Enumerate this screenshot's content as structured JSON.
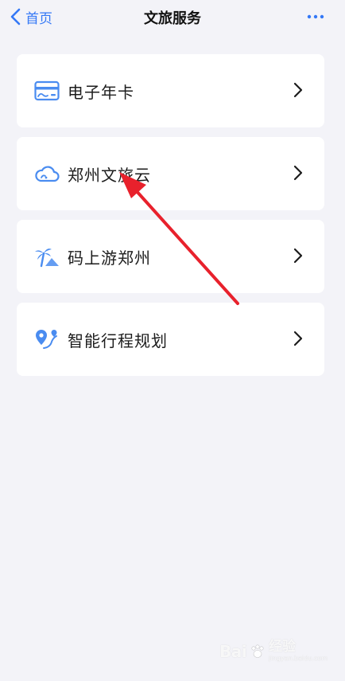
{
  "nav": {
    "back_label": "首页",
    "title": "文旅服务",
    "more_label": "···"
  },
  "services": [
    {
      "label": "电子年卡",
      "icon": "membership-card-icon"
    },
    {
      "label": "郑州文旅云",
      "icon": "cloud-icon"
    },
    {
      "label": "码上游郑州",
      "icon": "palm-tree-icon"
    },
    {
      "label": "智能行程规划",
      "icon": "map-pin-route-icon"
    }
  ],
  "colors": {
    "accent": "#3478f6",
    "icon_blue": "#4a8cf0",
    "annotation": "#e8212c",
    "background": "#f3f3f8"
  },
  "watermark": {
    "brand": "Bai",
    "brand_cn": "经验",
    "site": "jingyan.baidu.com"
  }
}
